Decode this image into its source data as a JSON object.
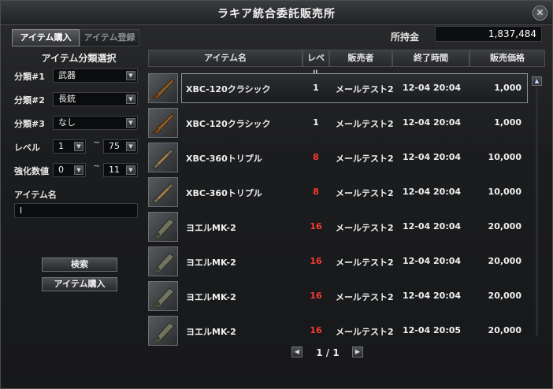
{
  "window": {
    "title": "ラキア統合委託販売所"
  },
  "tabs": [
    {
      "label": "アイテム購入"
    },
    {
      "label": "アイテム登録"
    }
  ],
  "money": {
    "label": "所持金",
    "value": "1,837,484"
  },
  "filter": {
    "section_title": "アイテム分類選択",
    "cat1": {
      "label": "分類#1",
      "value": "武器"
    },
    "cat2": {
      "label": "分類#2",
      "value": "長銃"
    },
    "cat3": {
      "label": "分類#3",
      "value": "なし"
    },
    "level": {
      "label": "レベル",
      "min": "1",
      "max": "75",
      "sep": "~"
    },
    "enhance": {
      "label": "強化数値",
      "min": "0",
      "max": "11",
      "sep": "~"
    },
    "item_name": {
      "label": "アイテム名",
      "value": "l"
    },
    "search_button": "検索",
    "buy_button": "アイテム購入"
  },
  "table": {
    "headers": {
      "name": "アイテム名",
      "level": "レベル",
      "seller": "販売者",
      "end_time": "終了時間",
      "price": "販売価格"
    },
    "rows": [
      {
        "name": "XBC-120クラシック",
        "level": "1",
        "seller": "メールテスト2",
        "end_time": "12-04 20:04",
        "price": "1,000",
        "level_color": "#f0f0f0"
      },
      {
        "name": "XBC-120クラシック",
        "level": "1",
        "seller": "メールテスト2",
        "end_time": "12-04 20:04",
        "price": "1,000",
        "level_color": "#f0f0f0"
      },
      {
        "name": "XBC-360トリプル",
        "level": "8",
        "seller": "メールテスト2",
        "end_time": "12-04 20:04",
        "price": "10,000",
        "level_color": "#ff3a2f"
      },
      {
        "name": "XBC-360トリプル",
        "level": "8",
        "seller": "メールテスト2",
        "end_time": "12-04 20:04",
        "price": "10,000",
        "level_color": "#ff3a2f"
      },
      {
        "name": "ヨエルMK-2",
        "level": "16",
        "seller": "メールテスト2",
        "end_time": "12-04 20:04",
        "price": "20,000",
        "level_color": "#ff3a2f"
      },
      {
        "name": "ヨエルMK-2",
        "level": "16",
        "seller": "メールテスト2",
        "end_time": "12-04 20:04",
        "price": "20,000",
        "level_color": "#ff3a2f"
      },
      {
        "name": "ヨエルMK-2",
        "level": "16",
        "seller": "メールテスト2",
        "end_time": "12-04 20:04",
        "price": "20,000",
        "level_color": "#ff3a2f"
      },
      {
        "name": "ヨエルMK-2",
        "level": "16",
        "seller": "メールテスト2",
        "end_time": "12-04 20:05",
        "price": "20,000",
        "level_color": "#ff3a2f"
      }
    ]
  },
  "pager": {
    "text": "1 / 1"
  },
  "icons": {
    "close": "close-icon",
    "dropdown": "chevron-down-icon",
    "scroll_up": "arrow-up-icon",
    "prev": "arrow-left-icon",
    "next": "arrow-right-icon"
  }
}
